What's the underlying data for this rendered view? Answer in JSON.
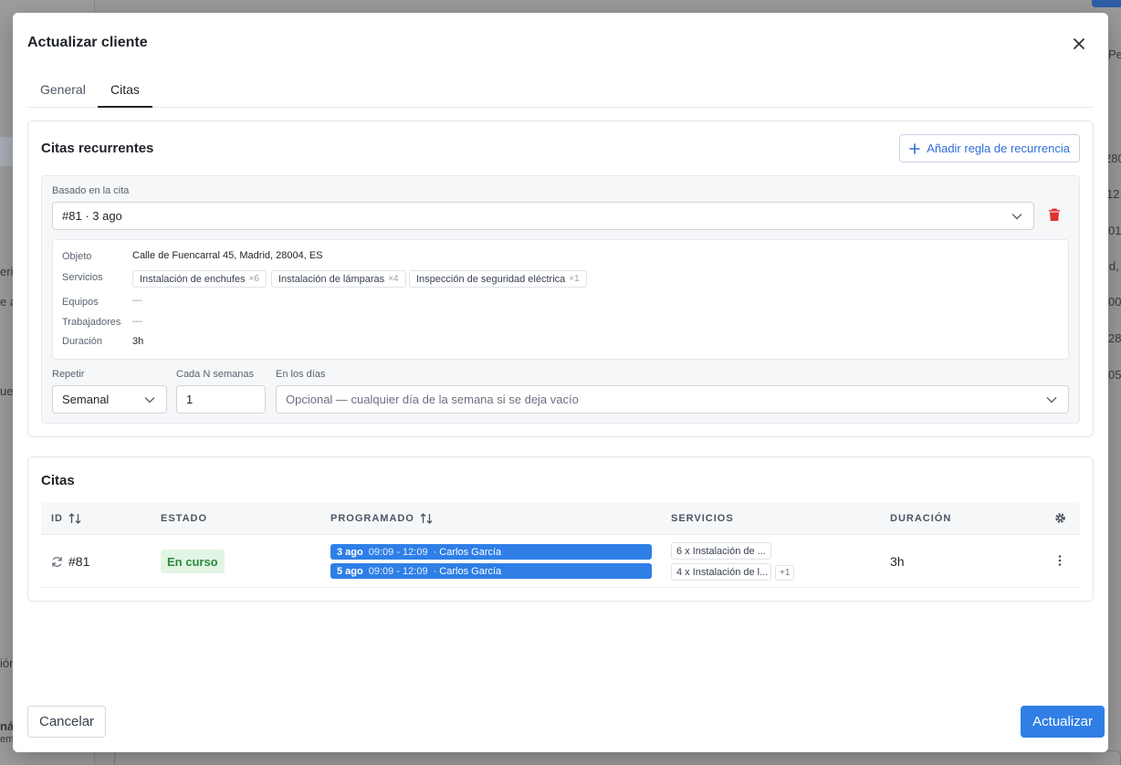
{
  "background": {
    "fragments": [
      "Pendi",
      "280",
      "12,",
      "01",
      "id,",
      "00",
      "28",
      "05",
      "eri",
      "e a",
      "ue",
      "ión",
      "ná",
      "em"
    ]
  },
  "modal": {
    "title": "Actualizar cliente",
    "tabs": [
      {
        "label": "General",
        "active": false
      },
      {
        "label": "Citas",
        "active": true
      }
    ]
  },
  "recurring": {
    "title": "Citas recurrentes",
    "add_button_label": "Añadir regla de recurrencia",
    "based_on_label": "Basado en la cita",
    "based_on_value": "#81 · 3 ago",
    "details": {
      "object_label": "Objeto",
      "object_value": "Calle de Fuencarral 45, Madrid, 28004, ES",
      "services_label": "Servicios",
      "services": [
        {
          "name": "Instalación de enchufes",
          "count": "×6"
        },
        {
          "name": "Instalación de lámparas",
          "count": "×4"
        },
        {
          "name": "Inspección de seguridad eléctrica",
          "count": "×1"
        }
      ],
      "equipment_label": "Equipos",
      "equipment_value": "—",
      "workers_label": "Trabajadores",
      "workers_value": "—",
      "duration_label": "Duración",
      "duration_value": "3h"
    },
    "repeat_label": "Repetir",
    "repeat_value": "Semanal",
    "every_n_label": "Cada N semanas",
    "every_n_value": "1",
    "days_label": "En los días",
    "days_placeholder": "Opcional — cualquier día de la semana si se deja vacío"
  },
  "appointments": {
    "title": "Citas",
    "columns": {
      "id": "ID",
      "status": "Estado",
      "scheduled": "Programado",
      "services": "Servicios",
      "duration": "Duración"
    },
    "rows": [
      {
        "id": "#81",
        "status": "En curso",
        "schedule": [
          {
            "date": "3 ago",
            "time": "09:09 - 12:09",
            "worker": "· Carlos García"
          },
          {
            "date": "5 ago",
            "time": "09:09 - 12:09",
            "worker": "· Carlos García"
          }
        ],
        "services": [
          "6 x Instalación de ...",
          "4 x Instalación de l..."
        ],
        "services_more": "+1",
        "duration": "3h"
      }
    ]
  },
  "footer": {
    "cancel_label": "Cancelar",
    "submit_label": "Actualizar"
  },
  "colors": {
    "primary": "#2f7fe6",
    "danger": "#e03131",
    "status_in_progress_bg": "#e2f5e4",
    "status_in_progress_text": "#2d8a3e"
  }
}
